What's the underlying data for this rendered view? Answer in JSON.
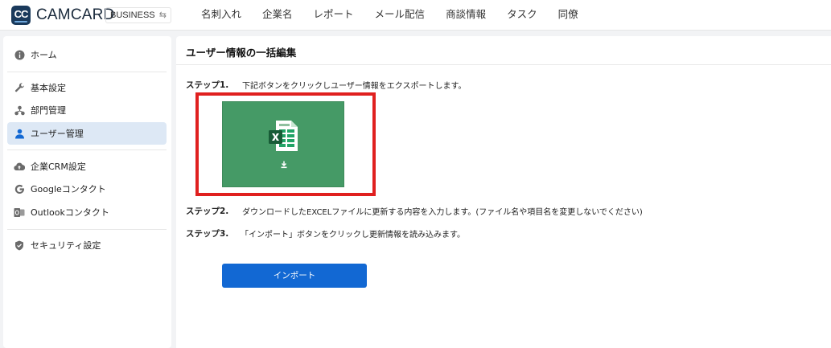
{
  "header": {
    "logo_text": "CC",
    "brand": "CAMCARD",
    "edition": "BUSINESS",
    "edition_switch_icon": "⇆",
    "nav": [
      "名刺入れ",
      "企業名",
      "レポート",
      "メール配信",
      "商談情報",
      "タスク",
      "同僚"
    ]
  },
  "sidebar": {
    "items": [
      {
        "label": "ホーム",
        "icon": "info-icon"
      },
      {
        "label": "基本設定",
        "icon": "wrench-icon"
      },
      {
        "label": "部門管理",
        "icon": "org-chart-icon"
      },
      {
        "label": "ユーザー管理",
        "icon": "user-icon",
        "active": true
      },
      {
        "label": "企業CRM設定",
        "icon": "cloud-upload-icon"
      },
      {
        "label": "Googleコンタクト",
        "icon": "google-icon"
      },
      {
        "label": "Outlookコンタクト",
        "icon": "outlook-icon"
      },
      {
        "label": "セキュリティ設定",
        "icon": "shield-icon"
      }
    ]
  },
  "main": {
    "title": "ユーザー情報の一括編集",
    "steps": [
      {
        "label": "ステップ1.",
        "text": "下記ボタンをクリックしユーザー情報をエクスポートします。"
      },
      {
        "label": "ステップ2.",
        "text": "ダウンロードしたEXCELファイルに更新する内容を入力します。(ファイル名や項目名を変更しないでください)"
      },
      {
        "label": "ステップ3.",
        "text": "「インポート」ボタンをクリックし更新情報を読み込みます。"
      }
    ],
    "export_tile": {
      "icon": "excel-icon",
      "action_icon": "download-icon"
    },
    "import_button": "インポート"
  },
  "colors": {
    "accent": "#1268d3",
    "excel_tile": "#459a66",
    "highlight_border": "#e0201f",
    "active_item_bg": "#dde8f5",
    "brand_dark": "#1a3a5c"
  }
}
